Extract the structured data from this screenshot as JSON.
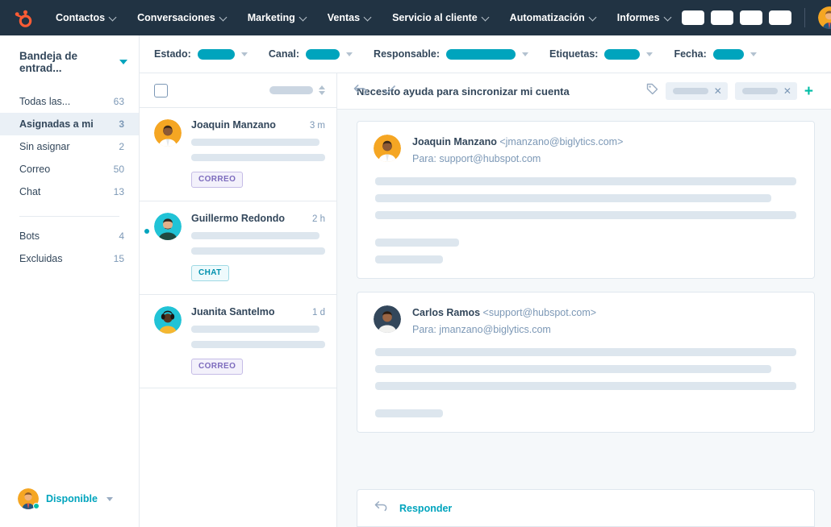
{
  "topnav": {
    "logo_icon": "hubspot-sprocket-logo",
    "items": [
      {
        "label": "Contactos"
      },
      {
        "label": "Conversaciones"
      },
      {
        "label": "Marketing"
      },
      {
        "label": "Ventas"
      },
      {
        "label": "Servicio al cliente"
      },
      {
        "label": "Automatización"
      },
      {
        "label": "Informes"
      }
    ],
    "placeholder_buttons": 4,
    "avatar_icon": "user-avatar",
    "avatar_caret_icon": "chevron-down-icon"
  },
  "sidebar": {
    "inbox_title": "Bandeja de entrad...",
    "inbox_caret_icon": "caret-down-icon",
    "items": [
      {
        "label": "Todas las...",
        "count": "63",
        "active": false
      },
      {
        "label": "Asignadas a mi",
        "count": "3",
        "active": true
      },
      {
        "label": "Sin asignar",
        "count": "2",
        "active": false
      },
      {
        "label": "Correo",
        "count": "50",
        "active": false
      },
      {
        "label": "Chat",
        "count": "13",
        "active": false
      }
    ],
    "items2": [
      {
        "label": "Bots",
        "count": "4",
        "active": false
      },
      {
        "label": "Excluidas",
        "count": "15",
        "active": false
      }
    ],
    "status": {
      "label": "Disponible",
      "avatar_icon": "user-avatar",
      "presence_icon": "online-dot",
      "caret_icon": "caret-down-icon"
    }
  },
  "filterbar": {
    "filters": [
      {
        "label": "Estado:",
        "pill_width": 46
      },
      {
        "label": "Canal:",
        "pill_width": 42
      },
      {
        "label": "Responsable:",
        "pill_width": 86
      },
      {
        "label": "Etiquetas:",
        "pill_width": 44
      },
      {
        "label": "Fecha:",
        "pill_width": 38
      }
    ],
    "caret_icon": "caret-down-icon"
  },
  "conversation_list": {
    "toolbar": {
      "select_all_icon": "checkbox-unchecked",
      "sort_placeholder_width": 54,
      "sort_icon": "sort-arrows-icon"
    },
    "items": [
      {
        "name": "Joaquin Manzano",
        "time": "3 m",
        "badge": "CORREO",
        "badge_type": "correo",
        "unread": false,
        "selected": false,
        "avatar_icon": "contact-avatar-joaquin",
        "preview_widths": [
          96,
          100
        ]
      },
      {
        "name": "Guillermo Redondo",
        "time": "2 h",
        "badge": "CHAT",
        "badge_type": "chat",
        "unread": true,
        "selected": true,
        "avatar_icon": "contact-avatar-guillermo",
        "preview_widths": [
          96,
          100
        ]
      },
      {
        "name": "Juanita Santelmo",
        "time": "1 d",
        "badge": "CORREO",
        "badge_type": "correo",
        "unread": false,
        "selected": false,
        "avatar_icon": "contact-avatar-juanita",
        "preview_widths": [
          96,
          100
        ]
      }
    ]
  },
  "detail": {
    "subject": "Necesito ayuda para sincronizar mi cuenta",
    "tag_icon": "tag-icon",
    "tags": [
      {
        "close_icon": "close-icon"
      },
      {
        "close_icon": "close-icon"
      }
    ],
    "add_tag_icon": "plus-icon",
    "add_tag_label": "+",
    "messages": [
      {
        "sender": "Joaquin Manzano",
        "sender_email": "<jmanzano@biglytics.com>",
        "to_label": "Para:",
        "to_email": "support@hubspot.com",
        "avatar_icon": "contact-avatar-joaquin",
        "body_lines": [
          100,
          94,
          100,
          0,
          28,
          22
        ]
      },
      {
        "sender": "Carlos Ramos",
        "sender_email": "<support@hubspot.com>",
        "to_label": "Para:",
        "to_email": "jmanzano@biglytics.com",
        "avatar_icon": "agent-avatar-carlos",
        "body_lines": [
          100,
          94,
          100,
          0,
          22
        ]
      }
    ],
    "reply": {
      "label": "Responder",
      "icon": "reply-arrow-icon"
    }
  },
  "toolbar_actions": {
    "reply_icon": "reply-arrow-icon",
    "check_icon": "checkmark-icon"
  },
  "colors": {
    "navy": "#213343",
    "teal": "#00a4bd",
    "green": "#00bda5",
    "orange": "#ff5c35",
    "purple": "#7c6bbd",
    "text": "#33475b",
    "muted": "#7c98b6",
    "skeleton": "#dde6ee",
    "page_bg": "#f5f8fa"
  }
}
